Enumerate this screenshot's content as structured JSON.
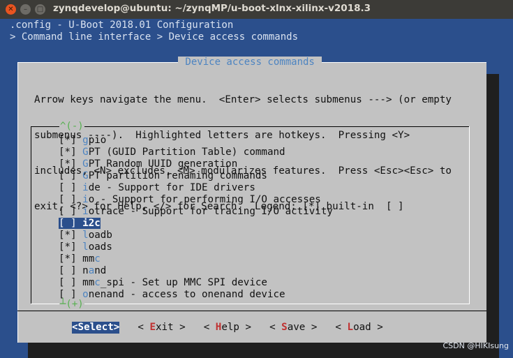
{
  "window": {
    "title": "zynqdevelop@ubuntu: ~/zynqMP/u-boot-xlnx-xilinx-v2018.3"
  },
  "terminal": {
    "config_line": ".config - U-Boot 2018.01 Configuration",
    "breadcrumb": "> Command line interface > Device access commands"
  },
  "dialog": {
    "title": " Device access commands ",
    "help_lines": [
      "Arrow keys navigate the menu.  <Enter> selects submenus ---> (or empty",
      "submenus ----).  Highlighted letters are hotkeys.  Pressing <Y>",
      "includes, <N> excludes, <M> modularizes features.  Press <Esc><Esc> to",
      "exit, <?> for Help, </> for Search.  Legend: [*] built-in  [ ]"
    ],
    "scroll_up": "^(-)",
    "scroll_down": "┴(+)",
    "items": [
      {
        "mark": "[*]",
        "hotkey": "g",
        "rest": "pio",
        "selected": false
      },
      {
        "mark": "[*]",
        "hotkey": "G",
        "rest": "PT (GUID Partition Table) command",
        "selected": false
      },
      {
        "mark": "[*]",
        "hotkey": "G",
        "rest": "PT Random UUID generation",
        "selected": false
      },
      {
        "mark": "[ ]",
        "hotkey": "G",
        "rest": "PT partition renaming commands",
        "selected": false
      },
      {
        "mark": "[ ]",
        "hotkey": "i",
        "rest": "de - Support for IDE drivers",
        "selected": false
      },
      {
        "mark": "[ ]",
        "hotkey": "i",
        "rest": "o - Support for performing I/O accesses",
        "selected": false
      },
      {
        "mark": "[ ]",
        "hotkey": "i",
        "rest": "otrace - Support for tracing I/O activity",
        "selected": false
      },
      {
        "mark": "[ ]",
        "hotkey": "i",
        "rest": "2c",
        "selected": true
      },
      {
        "mark": "[*]",
        "hotkey": "l",
        "rest": "oadb",
        "selected": false
      },
      {
        "mark": "[*]",
        "hotkey": "l",
        "rest": "oads",
        "selected": false
      },
      {
        "mark": "[*]",
        "pre": "mm",
        "hotkey": "c",
        "rest": "",
        "selected": false
      },
      {
        "mark": "[ ]",
        "pre": "n",
        "hotkey": "a",
        "rest": "nd",
        "selected": false
      },
      {
        "mark": "[ ]",
        "pre": "mm",
        "hotkey": "c",
        "rest": "_spi - Set up MMC SPI device",
        "selected": false
      },
      {
        "mark": "[ ]",
        "hotkey": "o",
        "rest": "nenand - access to onenand device",
        "selected": false
      }
    ],
    "buttons": [
      {
        "pre": "<",
        "hotkey": "S",
        "rest": "elect>",
        "active": true
      },
      {
        "pre": "< ",
        "hotkey": "E",
        "rest": "xit >",
        "active": false
      },
      {
        "pre": "< ",
        "hotkey": "H",
        "rest": "elp >",
        "active": false
      },
      {
        "pre": "< ",
        "hotkey": "S",
        "rest": "ave >",
        "active": false
      },
      {
        "pre": "< ",
        "hotkey": "L",
        "rest": "oad >",
        "active": false
      }
    ]
  },
  "watermark": "CSDN @HIKIsung",
  "colors": {
    "terminal_bg": "#2b4f8c",
    "dialog_bg": "#c2c2c2",
    "hotkey_blue": "#4d84c1",
    "button_hotkey_red": "#c03030",
    "selection_bg": "#2b4f8c",
    "scroll_indicator_green": "#57b050",
    "close_button_orange": "#e95420"
  }
}
